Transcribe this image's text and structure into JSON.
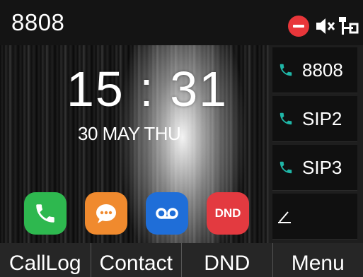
{
  "status_bar": {
    "account": "8808",
    "icons": [
      "dnd-icon",
      "mute-icon",
      "network-icon"
    ],
    "colors": {
      "dnd": "#e8363a"
    }
  },
  "idle": {
    "time": "15 : 31",
    "date": "30 MAY THU",
    "apps": [
      {
        "name": "phone-icon",
        "color": "#2eb84f"
      },
      {
        "name": "message-icon",
        "color": "#f08a2e"
      },
      {
        "name": "voicemail-icon",
        "color": "#1f6ed8"
      },
      {
        "name": "dnd-app-icon",
        "label": "DND",
        "color": "#e33a40"
      }
    ]
  },
  "line_keys": [
    {
      "label": "8808",
      "icon": "line-phone-icon"
    },
    {
      "label": "SIP2",
      "icon": "line-phone-icon"
    },
    {
      "label": "SIP3",
      "icon": "line-phone-icon"
    },
    {
      "label": "",
      "icon": "edit-icon"
    }
  ],
  "soft_keys": [
    "CallLog",
    "Contact",
    "DND",
    "Menu"
  ],
  "accent_color": "#1fb6a7"
}
